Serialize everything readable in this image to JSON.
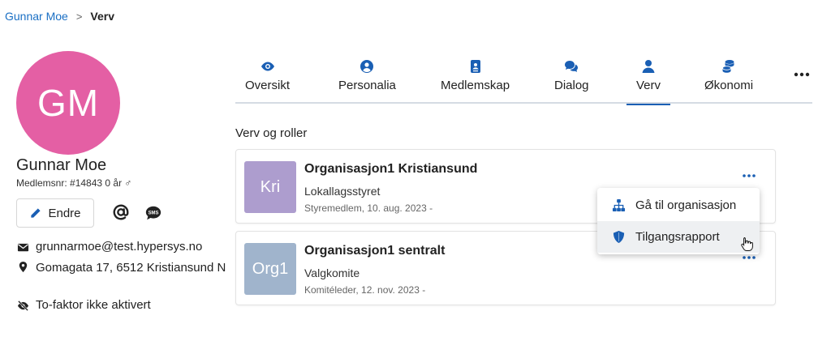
{
  "breadcrumb": {
    "parent": "Gunnar Moe",
    "separator": ">",
    "current": "Verv"
  },
  "profile": {
    "initials": "GM",
    "avatar_color": "#e45fa4",
    "name": "Gunnar Moe",
    "member_line": "Medlemsnr: #14843 0 år ♂",
    "edit_label": "Endre",
    "email": "grunnarmoe@test.hypersys.no",
    "address": "Gomagata 17, 6512 Kristiansund N",
    "twofactor": "To-faktor ikke aktivert"
  },
  "tabs": [
    {
      "label": "Oversikt",
      "icon": "eye-icon"
    },
    {
      "label": "Personalia",
      "icon": "user-circle-icon"
    },
    {
      "label": "Medlemskap",
      "icon": "id-card-icon"
    },
    {
      "label": "Dialog",
      "icon": "chat-icon"
    },
    {
      "label": "Verv",
      "icon": "user-icon",
      "active": true
    },
    {
      "label": "Økonomi",
      "icon": "coins-icon"
    }
  ],
  "section_title": "Verv og roller",
  "cards": [
    {
      "thumb": "Kri",
      "thumb_color": "#ad9dce",
      "title": "Organisasjon1 Kristiansund",
      "subtitle": "Lokallagsstyret",
      "meta": "Styremedlem, 10. aug. 2023 -"
    },
    {
      "thumb": "Org1",
      "thumb_color": "#a0b4cc",
      "title": "Organisasjon1 sentralt",
      "subtitle": "Valgkomite",
      "meta": "Komitéleder, 12. nov. 2023 -"
    }
  ],
  "dropdown": {
    "items": [
      {
        "label": "Gå til organisasjon",
        "icon": "sitemap-icon"
      },
      {
        "label": "Tilgangsrapport",
        "icon": "shield-icon"
      }
    ]
  },
  "colors": {
    "accent": "#1a5fb4",
    "link": "#1a6fc4"
  }
}
